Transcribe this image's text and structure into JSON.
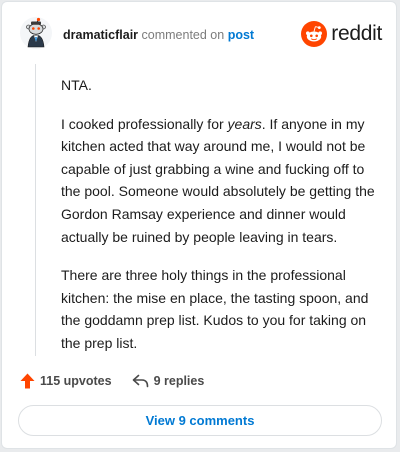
{
  "header": {
    "username": "dramaticflair",
    "action_text": "commented on",
    "target_text": "post",
    "brand": "reddit"
  },
  "comment": {
    "paragraphs": [
      {
        "text": "NTA."
      },
      {
        "before": "I cooked professionally for ",
        "emphasis": "years",
        "after": ". If anyone in my kitchen acted that way around me, I would not be capable of just grabbing a wine and fucking off to the pool. Someone would absolutely be getting the Gordon Ramsay experience and dinner would actually be ruined by people leaving in tears."
      },
      {
        "text": "There are three holy things in the professional kitchen: the mise en place, the tasting spoon, and the goddamn prep list. Kudos to you for taking on the prep list."
      }
    ]
  },
  "actions": {
    "upvotes": "115 upvotes",
    "replies": "9 replies"
  },
  "footer": {
    "view_comments": "View 9 comments"
  },
  "colors": {
    "brand_orange": "#ff4500",
    "link_blue": "#0079d3",
    "upvote_orange": "#ff4500"
  }
}
